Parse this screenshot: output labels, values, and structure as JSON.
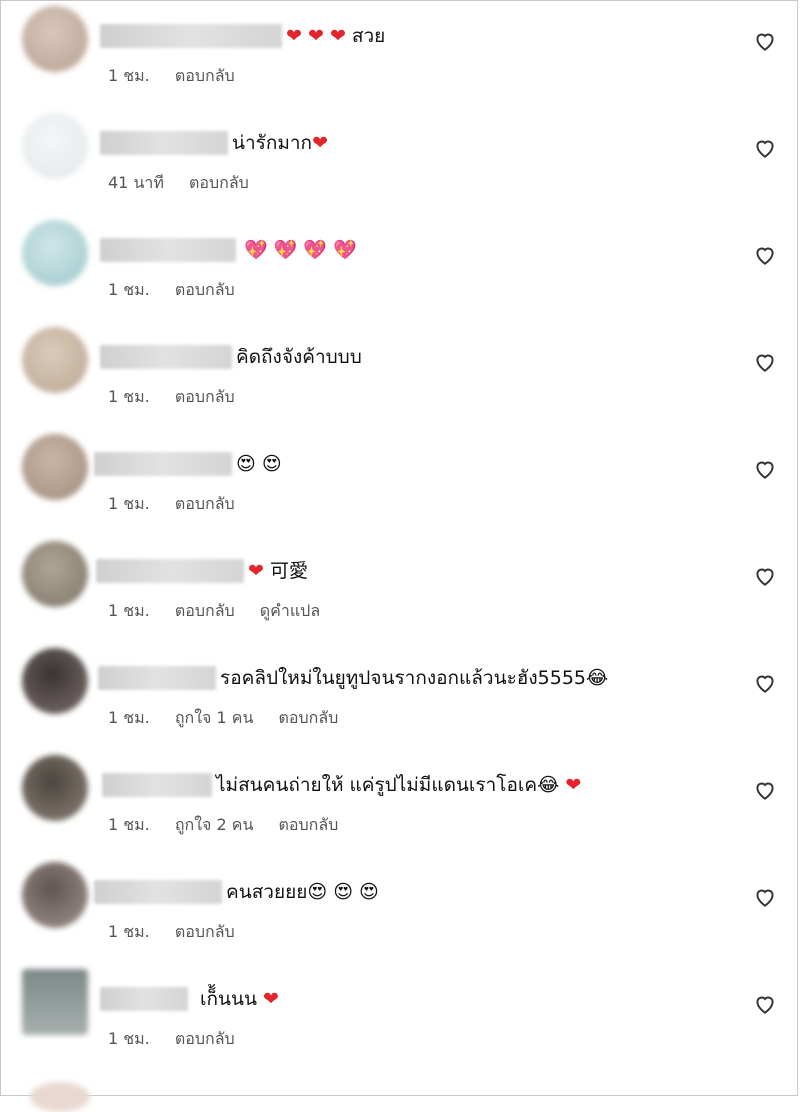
{
  "comments": [
    {
      "text": "❤ ❤ ❤ สวย",
      "time": "1 ชม.",
      "likes": "",
      "reply": "ตอบกลับ",
      "translate": "",
      "avatar_color": "#cbb7a9"
    },
    {
      "text": "น่ารักมาก❤",
      "time": "41 นาที",
      "likes": "",
      "reply": "ตอบกลับ",
      "translate": "",
      "avatar_color": "#e9eef0"
    },
    {
      "text": "💖 💖 💖 💖",
      "time": "1 ชม.",
      "likes": "",
      "reply": "ตอบกลับ",
      "translate": "",
      "avatar_color": "#b7d6d8"
    },
    {
      "text": "คิดถึงจังค้าบบบ",
      "time": "1 ชม.",
      "likes": "",
      "reply": "ตอบกลับ",
      "translate": "",
      "avatar_color": "#cdbcaa"
    },
    {
      "text": "😍 😍",
      "time": "1 ชม.",
      "likes": "",
      "reply": "ตอบกลับ",
      "translate": "",
      "avatar_color": "#b9a596"
    },
    {
      "text": "❤ 可愛",
      "time": "1 ชม.",
      "likes": "",
      "reply": "ตอบกลับ",
      "translate": "ดูคำแปล",
      "avatar_color": "#9c9588"
    },
    {
      "text": "รอคลิปใหม่ในยูทูปจนรากงอกแล้วนะฮัง5555😂",
      "time": "1 ชม.",
      "likes": "ถูกใจ 1 คน",
      "reply": "ตอบกลับ",
      "translate": "",
      "avatar_color": "#5e5454"
    },
    {
      "text": "ไม่สนคนถ่ายให้ แค่รูปไม่มีแดนเราโอเค😂 ❤",
      "time": "1 ชม.",
      "likes": "ถูกใจ 2 คน",
      "reply": "ตอบกลับ",
      "translate": "",
      "avatar_color": "#6e6660"
    },
    {
      "text": "คนสวยยย😍 😍 😍",
      "time": "1 ชม.",
      "likes": "",
      "reply": "ตอบกลับ",
      "translate": "",
      "avatar_color": "#7f7470"
    },
    {
      "text": "เก็้นนน ❤",
      "time": "1 ชม.",
      "likes": "",
      "reply": "ตอบกลับ",
      "translate": "",
      "avatar_color": "#8e9997"
    }
  ],
  "colors": {
    "heart_red": "#e3242b",
    "meta_gray": "#555555"
  },
  "icons": {
    "like_button": "heart-outline-icon"
  }
}
